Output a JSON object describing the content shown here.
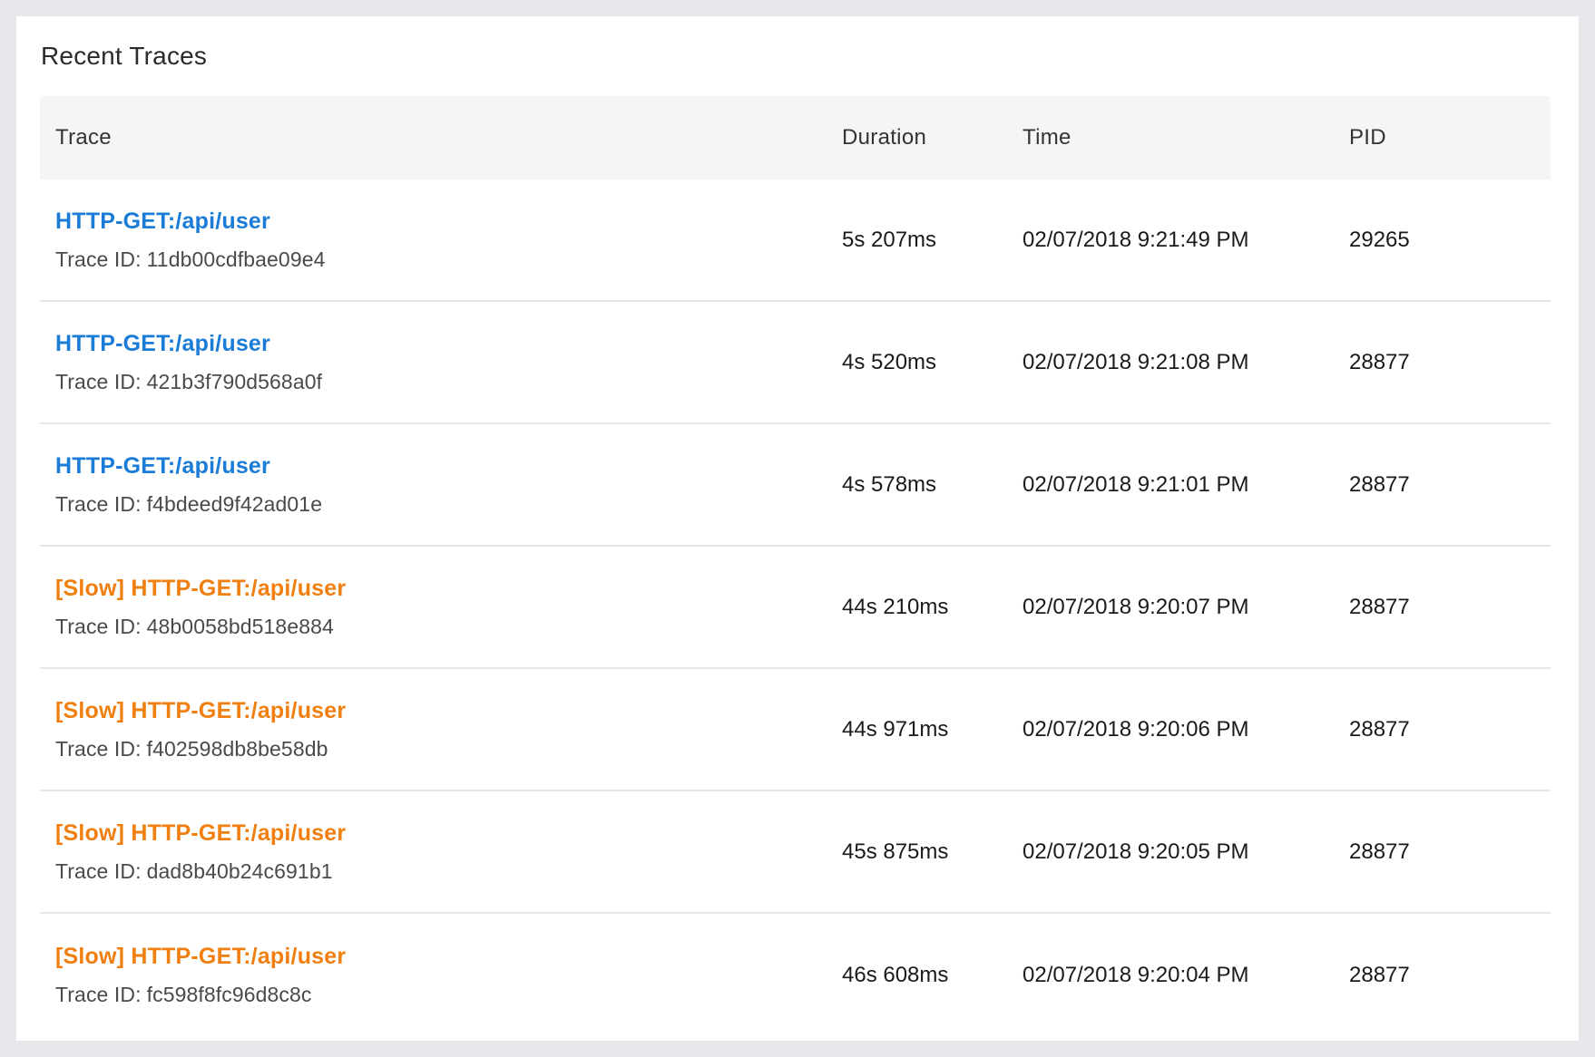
{
  "panel": {
    "title": "Recent Traces"
  },
  "table": {
    "headers": {
      "trace": "Trace",
      "duration": "Duration",
      "time": "Time",
      "pid": "PID"
    },
    "trace_id_prefix": "Trace ID:",
    "rows": [
      {
        "name": "HTTP-GET:/api/user",
        "slow": false,
        "trace_id": "11db00cdfbae09e4",
        "duration": "5s 207ms",
        "time": "02/07/2018 9:21:49 PM",
        "pid": "29265"
      },
      {
        "name": "HTTP-GET:/api/user",
        "slow": false,
        "trace_id": "421b3f790d568a0f",
        "duration": "4s 520ms",
        "time": "02/07/2018 9:21:08 PM",
        "pid": "28877"
      },
      {
        "name": "HTTP-GET:/api/user",
        "slow": false,
        "trace_id": "f4bdeed9f42ad01e",
        "duration": "4s 578ms",
        "time": "02/07/2018 9:21:01 PM",
        "pid": "28877"
      },
      {
        "name": "[Slow] HTTP-GET:/api/user",
        "slow": true,
        "trace_id": "48b0058bd518e884",
        "duration": "44s 210ms",
        "time": "02/07/2018 9:20:07 PM",
        "pid": "28877"
      },
      {
        "name": "[Slow] HTTP-GET:/api/user",
        "slow": true,
        "trace_id": "f402598db8be58db",
        "duration": "44s 971ms",
        "time": "02/07/2018 9:20:06 PM",
        "pid": "28877"
      },
      {
        "name": "[Slow] HTTP-GET:/api/user",
        "slow": true,
        "trace_id": "dad8b40b24c691b1",
        "duration": "45s 875ms",
        "time": "02/07/2018 9:20:05 PM",
        "pid": "28877"
      },
      {
        "name": "[Slow] HTTP-GET:/api/user",
        "slow": true,
        "trace_id": "fc598f8fc96d8c8c",
        "duration": "46s 608ms",
        "time": "02/07/2018 9:20:04 PM",
        "pid": "28877"
      }
    ]
  },
  "colors": {
    "link_normal": "#1a7cd6",
    "link_slow": "#f07f10",
    "header_bg": "#f5f5f5",
    "page_bg": "#e6e8ec"
  }
}
